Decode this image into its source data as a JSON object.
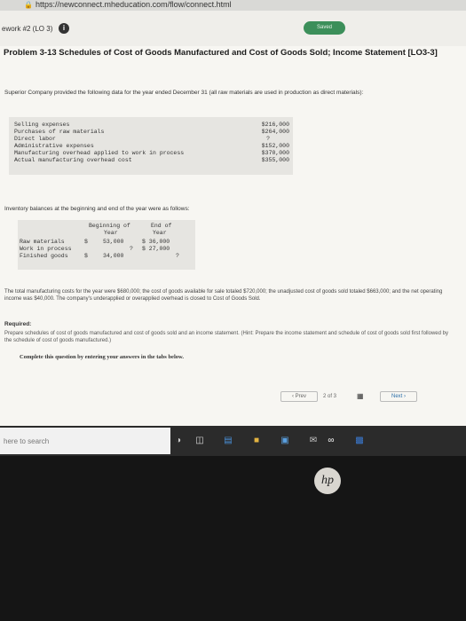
{
  "browser": {
    "url": "https://newconnect.mheducation.com/flow/connect.html"
  },
  "header": {
    "assignment": "ework #2 (LO 3)",
    "info_icon": "i",
    "saved_label": "Saved"
  },
  "problem": {
    "title": "Problem 3-13 Schedules of Cost of Goods Manufactured and Cost of Goods Sold; Income Statement [LO3-3]",
    "intro": "Superior Company provided the following data for the year ended December 31 (all raw materials are used in production as direct materials):"
  },
  "data_table": [
    {
      "label": "Selling expenses",
      "value": "$216,000"
    },
    {
      "label": "Purchases of raw materials",
      "value": "$264,000"
    },
    {
      "label": "Direct labor",
      "value": "?"
    },
    {
      "label": "Administrative expenses",
      "value": "$152,000"
    },
    {
      "label": "Manufacturing overhead applied to work in process",
      "value": "$370,000"
    },
    {
      "label": "Actual manufacturing overhead cost",
      "value": "$355,000"
    }
  ],
  "inventory": {
    "intro": "Inventory balances at the beginning and end of the year were as follows:",
    "col1_line1": "Beginning of",
    "col1_line2": "Year",
    "col2_line1": "End of",
    "col2_line2": "Year",
    "rows": [
      {
        "label": "Raw materials",
        "sign": "$",
        "begin": "53,000",
        "end": "$ 36,000"
      },
      {
        "label": "Work in process",
        "sign": "",
        "begin": "?",
        "end": "$ 27,000"
      },
      {
        "label": "Finished goods",
        "sign": "$",
        "begin": "34,000",
        "end": "?"
      }
    ]
  },
  "summary": "The total manufacturing costs for the year were $680,000; the cost of goods available for sale totaled $720,000; the unadjusted cost of goods sold totaled $663,000; and the net operating income was $40,000. The company's underapplied or overapplied overhead is closed to Cost of Goods Sold.",
  "required": {
    "heading": "Required:",
    "text": "Prepare schedules of cost of goods manufactured and cost of goods sold and an income statement. (Hint: Prepare the income statement and schedule of cost of goods sold first followed by the schedule of cost of goods manufactured.)"
  },
  "instruction": "Complete this question by entering your answers in the tabs below.",
  "navigation": {
    "prev_label": "Prev",
    "page_text": "2 of 3",
    "next_label": "Next"
  },
  "taskbar": {
    "search_placeholder": "here to search"
  },
  "bezel": {
    "logo": "hp"
  }
}
